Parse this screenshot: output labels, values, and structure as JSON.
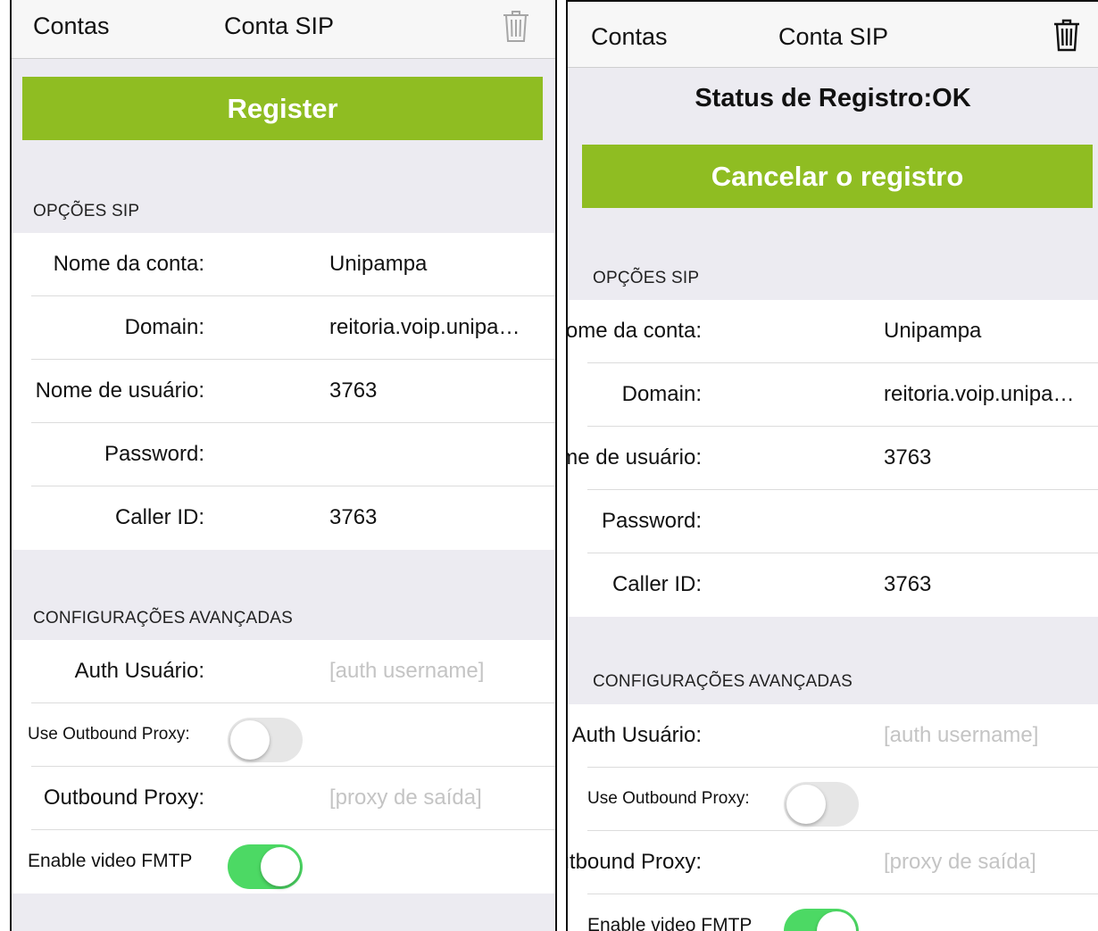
{
  "screens": [
    {
      "nav": {
        "back_label": "Contas",
        "title": "Conta SIP"
      },
      "status": "",
      "action_button": "Register",
      "sip_header": "OPÇÕES SIP",
      "sip_rows": [
        {
          "label": "Nome da conta:",
          "value": "Unipampa"
        },
        {
          "label": "Domain:",
          "value": "reitoria.voip.unipa…"
        },
        {
          "label": "Nome de usuário:",
          "value": "3763"
        },
        {
          "label": "Password:",
          "value": ""
        },
        {
          "label": "Caller ID:",
          "value": "3763"
        }
      ],
      "advanced_header": "CONFIGURAÇÕES AVANÇADAS",
      "advanced": {
        "auth_label": "Auth Usuário:",
        "auth_placeholder": "[auth username]",
        "outbound_toggle_label": "Use Outbound Proxy:",
        "outbound_toggle_on": false,
        "proxy_label": "Outbound Proxy:",
        "proxy_placeholder": "[proxy de saída]",
        "video_label": "Enable video FMTP",
        "video_toggle_on": true
      }
    },
    {
      "nav": {
        "back_label": "Contas",
        "title": "Conta SIP"
      },
      "status": "Status de Registro:OK",
      "action_button": "Cancelar o registro",
      "sip_header": "OPÇÕES SIP",
      "sip_rows": [
        {
          "label": "Nome da conta:",
          "value": "Unipampa"
        },
        {
          "label": "Domain:",
          "value": "reitoria.voip.unipa…"
        },
        {
          "label": "Nome de usuário:",
          "value": "3763"
        },
        {
          "label": "Password:",
          "value": ""
        },
        {
          "label": "Caller ID:",
          "value": "3763"
        }
      ],
      "advanced_header": "CONFIGURAÇÕES AVANÇADAS",
      "advanced": {
        "auth_label": "Auth Usuário:",
        "auth_placeholder": "[auth username]",
        "outbound_toggle_label": "Use Outbound Proxy:",
        "outbound_toggle_on": false,
        "proxy_label": "Outbound Proxy:",
        "proxy_placeholder": "[proxy de saída]",
        "video_label": "Enable video FMTP",
        "video_toggle_on": true
      }
    }
  ],
  "colors": {
    "accent_green": "#8fbd22",
    "toggle_on": "#4cd964",
    "toggle_off": "#e6e6e6",
    "group_background": "#ecebf1",
    "placeholder": "#c4c4c4"
  },
  "icons": {
    "delete": "trash-icon"
  }
}
